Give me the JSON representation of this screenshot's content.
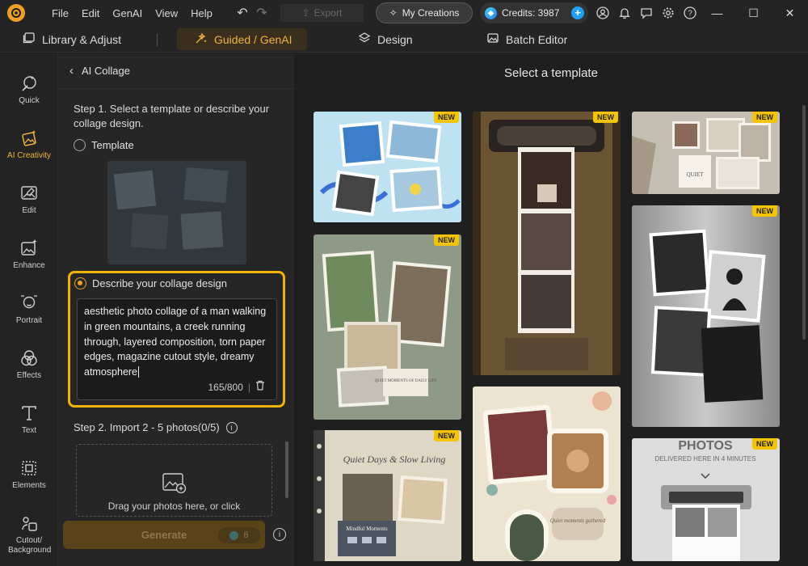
{
  "menu": [
    "File",
    "Edit",
    "GenAI",
    "View",
    "Help"
  ],
  "toolbar": {
    "export_label": "Export",
    "my_creations_label": "My Creations",
    "credits_label": "Credits: 3987"
  },
  "tabs": [
    {
      "label": "Library & Adjust"
    },
    {
      "label": "Guided / GenAI"
    },
    {
      "label": "Design"
    },
    {
      "label": "Batch Editor"
    }
  ],
  "rail": [
    {
      "label": "Quick"
    },
    {
      "label": "AI Creativity"
    },
    {
      "label": "Edit"
    },
    {
      "label": "Enhance"
    },
    {
      "label": "Portrait"
    },
    {
      "label": "Effects"
    },
    {
      "label": "Text"
    },
    {
      "label": "Elements"
    },
    {
      "label": "Cutout/ Background"
    }
  ],
  "panel": {
    "title": "AI Collage",
    "step1": "Step 1. Select a template or describe your collage design.",
    "option_template": "Template",
    "option_describe": "Describe your collage design",
    "prompt_text": "aesthetic photo collage of a man walking in green mountains, a creek running through, layered composition, torn paper edges, magazine cutout style, dreamy atmosphere",
    "char_count": "165/800",
    "step2": "Step 2. Import 2 - 5 photos(0/5)",
    "dropzone_text": "Drag your photos here, or click",
    "generate_label": "Generate",
    "generate_cost": "6"
  },
  "main": {
    "title": "Select a template",
    "new_badge": "NEW",
    "template_texts": {
      "quiet_moments": "QUIET MOMENTS OF DAILY LIFE",
      "quiet_days": "Quiet Days & Slow Living",
      "mindful": "Mindful Moments",
      "quiet_gathered": "Quiet moments gathered",
      "photos_header": "PHOTOS",
      "photos_sub": "DELIVERED HERE IN 4 MINUTES",
      "quiet_label": "QUIET"
    }
  },
  "colors": {
    "accent": "#f0b23a",
    "highlight_border": "#f0b400",
    "badge": "#f4c400"
  }
}
